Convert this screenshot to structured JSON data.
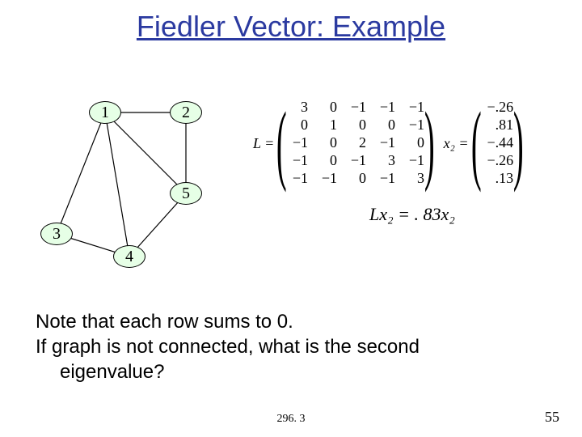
{
  "title": "Fiedler Vector: Example",
  "graph": {
    "nodes": [
      "1",
      "2",
      "3",
      "4",
      "5"
    ]
  },
  "matrix": {
    "lhs": "L =",
    "rows": [
      [
        "3",
        "0",
        "−1",
        "−1",
        "−1"
      ],
      [
        "0",
        "1",
        "0",
        "0",
        "−1"
      ],
      [
        "−1",
        "0",
        "2",
        "−1",
        "0"
      ],
      [
        "−1",
        "0",
        "−1",
        "3",
        "−1"
      ],
      [
        "−1",
        "−1",
        "0",
        "−1",
        "3"
      ]
    ]
  },
  "vector": {
    "lhs": "x₂ =",
    "values": [
      "−.26",
      ".81",
      "−.44",
      "−.26",
      ".13"
    ]
  },
  "equation": "Lx₂ = . 83x₂",
  "notes": {
    "line1": "Note that each row sums to 0.",
    "line2": "If graph is not connected, what is the second",
    "line3": "eigenvalue?"
  },
  "footer": {
    "center": "296. 3",
    "right": "55"
  }
}
